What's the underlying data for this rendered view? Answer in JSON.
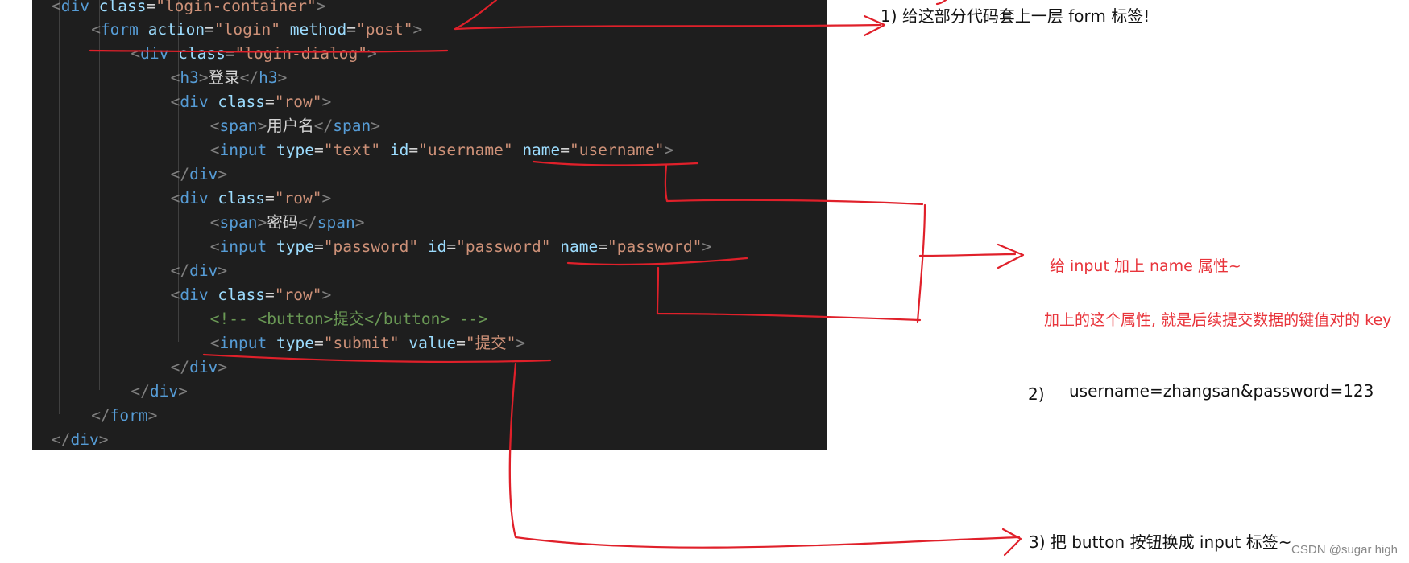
{
  "code_lines": [
    [
      {
        "t": "<",
        "c": "punc"
      },
      {
        "t": "div",
        "c": "tag"
      },
      {
        "t": " ",
        "c": "text"
      },
      {
        "t": "class",
        "c": "attr"
      },
      {
        "t": "=",
        "c": "text"
      },
      {
        "t": "\"login-container\"",
        "c": "str"
      },
      {
        "t": ">",
        "c": "punc"
      }
    ],
    [
      {
        "t": "<",
        "c": "punc"
      },
      {
        "t": "form",
        "c": "tag"
      },
      {
        "t": " ",
        "c": "text"
      },
      {
        "t": "action",
        "c": "attr"
      },
      {
        "t": "=",
        "c": "text"
      },
      {
        "t": "\"login\"",
        "c": "str"
      },
      {
        "t": " ",
        "c": "text"
      },
      {
        "t": "method",
        "c": "attr"
      },
      {
        "t": "=",
        "c": "text"
      },
      {
        "t": "\"post\"",
        "c": "str"
      },
      {
        "t": ">",
        "c": "punc"
      }
    ],
    [
      {
        "t": "<",
        "c": "punc"
      },
      {
        "t": "div",
        "c": "tag"
      },
      {
        "t": " ",
        "c": "text"
      },
      {
        "t": "class",
        "c": "attr"
      },
      {
        "t": "=",
        "c": "text"
      },
      {
        "t": "\"login-dialog\"",
        "c": "str"
      },
      {
        "t": ">",
        "c": "punc"
      }
    ],
    [
      {
        "t": "<",
        "c": "punc"
      },
      {
        "t": "h3",
        "c": "tag"
      },
      {
        "t": ">",
        "c": "punc"
      },
      {
        "t": "登录",
        "c": "text"
      },
      {
        "t": "</",
        "c": "punc"
      },
      {
        "t": "h3",
        "c": "tag"
      },
      {
        "t": ">",
        "c": "punc"
      }
    ],
    [
      {
        "t": "<",
        "c": "punc"
      },
      {
        "t": "div",
        "c": "tag"
      },
      {
        "t": " ",
        "c": "text"
      },
      {
        "t": "class",
        "c": "attr"
      },
      {
        "t": "=",
        "c": "text"
      },
      {
        "t": "\"row\"",
        "c": "str"
      },
      {
        "t": ">",
        "c": "punc"
      }
    ],
    [
      {
        "t": "<",
        "c": "punc"
      },
      {
        "t": "span",
        "c": "tag"
      },
      {
        "t": ">",
        "c": "punc"
      },
      {
        "t": "用户名",
        "c": "text"
      },
      {
        "t": "</",
        "c": "punc"
      },
      {
        "t": "span",
        "c": "tag"
      },
      {
        "t": ">",
        "c": "punc"
      }
    ],
    [
      {
        "t": "<",
        "c": "punc"
      },
      {
        "t": "input",
        "c": "tag"
      },
      {
        "t": " ",
        "c": "text"
      },
      {
        "t": "type",
        "c": "attr"
      },
      {
        "t": "=",
        "c": "text"
      },
      {
        "t": "\"text\"",
        "c": "str"
      },
      {
        "t": " ",
        "c": "text"
      },
      {
        "t": "id",
        "c": "attr"
      },
      {
        "t": "=",
        "c": "text"
      },
      {
        "t": "\"username\"",
        "c": "str"
      },
      {
        "t": " ",
        "c": "text"
      },
      {
        "t": "name",
        "c": "attr"
      },
      {
        "t": "=",
        "c": "text"
      },
      {
        "t": "\"username\"",
        "c": "str"
      },
      {
        "t": ">",
        "c": "punc"
      }
    ],
    [
      {
        "t": "</",
        "c": "punc"
      },
      {
        "t": "div",
        "c": "tag"
      },
      {
        "t": ">",
        "c": "punc"
      }
    ],
    [
      {
        "t": "<",
        "c": "punc"
      },
      {
        "t": "div",
        "c": "tag"
      },
      {
        "t": " ",
        "c": "text"
      },
      {
        "t": "class",
        "c": "attr"
      },
      {
        "t": "=",
        "c": "text"
      },
      {
        "t": "\"row\"",
        "c": "str"
      },
      {
        "t": ">",
        "c": "punc"
      }
    ],
    [
      {
        "t": "<",
        "c": "punc"
      },
      {
        "t": "span",
        "c": "tag"
      },
      {
        "t": ">",
        "c": "punc"
      },
      {
        "t": "密码",
        "c": "text"
      },
      {
        "t": "</",
        "c": "punc"
      },
      {
        "t": "span",
        "c": "tag"
      },
      {
        "t": ">",
        "c": "punc"
      }
    ],
    [
      {
        "t": "<",
        "c": "punc"
      },
      {
        "t": "input",
        "c": "tag"
      },
      {
        "t": " ",
        "c": "text"
      },
      {
        "t": "type",
        "c": "attr"
      },
      {
        "t": "=",
        "c": "text"
      },
      {
        "t": "\"password\"",
        "c": "str"
      },
      {
        "t": " ",
        "c": "text"
      },
      {
        "t": "id",
        "c": "attr"
      },
      {
        "t": "=",
        "c": "text"
      },
      {
        "t": "\"password\"",
        "c": "str"
      },
      {
        "t": " ",
        "c": "text"
      },
      {
        "t": "name",
        "c": "attr"
      },
      {
        "t": "=",
        "c": "text"
      },
      {
        "t": "\"password\"",
        "c": "str"
      },
      {
        "t": ">",
        "c": "punc"
      }
    ],
    [
      {
        "t": "</",
        "c": "punc"
      },
      {
        "t": "div",
        "c": "tag"
      },
      {
        "t": ">",
        "c": "punc"
      }
    ],
    [
      {
        "t": "<",
        "c": "punc"
      },
      {
        "t": "div",
        "c": "tag"
      },
      {
        "t": " ",
        "c": "text"
      },
      {
        "t": "class",
        "c": "attr"
      },
      {
        "t": "=",
        "c": "text"
      },
      {
        "t": "\"row\"",
        "c": "str"
      },
      {
        "t": ">",
        "c": "punc"
      }
    ],
    [
      {
        "t": "<!-- <button>提交</button> -->",
        "c": "comment"
      }
    ],
    [
      {
        "t": "<",
        "c": "punc"
      },
      {
        "t": "input",
        "c": "tag"
      },
      {
        "t": " ",
        "c": "text"
      },
      {
        "t": "type",
        "c": "attr"
      },
      {
        "t": "=",
        "c": "text"
      },
      {
        "t": "\"submit\"",
        "c": "str"
      },
      {
        "t": " ",
        "c": "text"
      },
      {
        "t": "value",
        "c": "attr"
      },
      {
        "t": "=",
        "c": "text"
      },
      {
        "t": "\"提交\"",
        "c": "str"
      },
      {
        "t": ">",
        "c": "punc"
      }
    ],
    [
      {
        "t": "</",
        "c": "punc"
      },
      {
        "t": "div",
        "c": "tag"
      },
      {
        "t": ">",
        "c": "punc"
      }
    ],
    [
      {
        "t": "</",
        "c": "punc"
      },
      {
        "t": "div",
        "c": "tag"
      },
      {
        "t": ">",
        "c": "punc"
      }
    ],
    [
      {
        "t": "</",
        "c": "punc"
      },
      {
        "t": "form",
        "c": "tag"
      },
      {
        "t": ">",
        "c": "punc"
      }
    ],
    [
      {
        "t": "</",
        "c": "punc"
      },
      {
        "t": "div",
        "c": "tag"
      },
      {
        "t": ">",
        "c": "punc"
      }
    ]
  ],
  "annotations": {
    "step1": "1) 给这部分代码套上一层 form 标签!",
    "name_attr": "给 input 加上 name 属性~",
    "name_attr_note": "加上的这个属性, 就是后续提交数据的键值对的 key",
    "step2_num": "2)",
    "step2_value": "username=zhangsan&password=123",
    "step3": "3) 把 button 按钮换成 input 标签~"
  },
  "watermark": "CSDN @sugar high",
  "colors": {
    "editor_bg": "#1e1e1e",
    "tag": "#569cd6",
    "attr": "#9cdcfe",
    "string": "#ce9178",
    "text": "#d4d4d4",
    "comment": "#6a9955",
    "punct": "#808080",
    "ink": "#e0202a"
  }
}
